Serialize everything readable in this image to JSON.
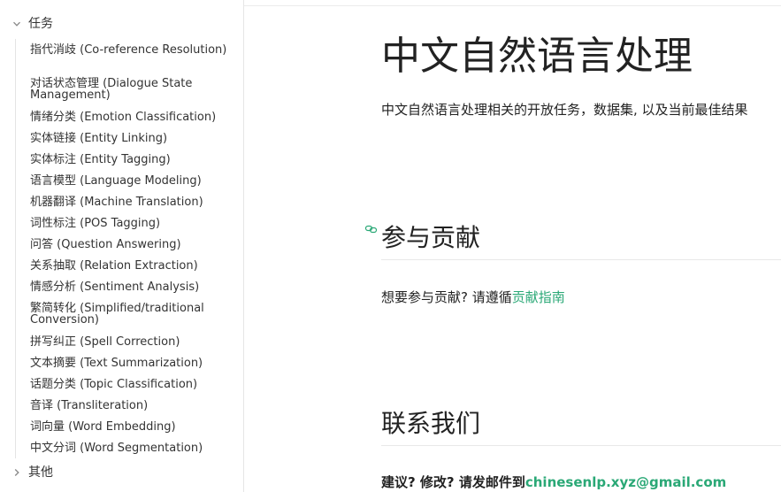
{
  "sidebar": {
    "group_tasks": {
      "label": "任务",
      "expanded": true
    },
    "items": [
      "指代消歧 (Co-reference Resolution)",
      "对话状态管理 (Dialogue State Management)",
      "情绪分类 (Emotion Classification)",
      "实体链接 (Entity Linking)",
      "实体标注 (Entity Tagging)",
      "语言模型 (Language Modeling)",
      "机器翻译 (Machine Translation)",
      "词性标注 (POS Tagging)",
      "问答 (Question Answering)",
      "关系抽取 (Relation Extraction)",
      "情感分析 (Sentiment Analysis)",
      "繁简转化 (Simplified/traditional Conversion)",
      "拼写纠正 (Spell Correction)",
      "文本摘要 (Text Summarization)",
      "话题分类 (Topic Classification)",
      "音译 (Transliteration)",
      "词向量 (Word Embedding)",
      "中文分词 (Word Segmentation)"
    ],
    "group_other": {
      "label": "其他",
      "expanded": false
    }
  },
  "main": {
    "title": "中文自然语言处理",
    "description": "中文自然语言处理相关的开放任务，数据集, 以及当前最佳结果",
    "contribute": {
      "heading": "参与贡献",
      "text": "想要参与贡献? 请遵循",
      "link": "贡献指南"
    },
    "contact": {
      "heading": "联系我们",
      "text": "建议? 修改? 请发邮件到",
      "email": "chinesenlp.xyz@gmail.com"
    }
  },
  "colors": {
    "link": "#2aa876",
    "text": "#222222",
    "border": "#e6e6e6"
  }
}
